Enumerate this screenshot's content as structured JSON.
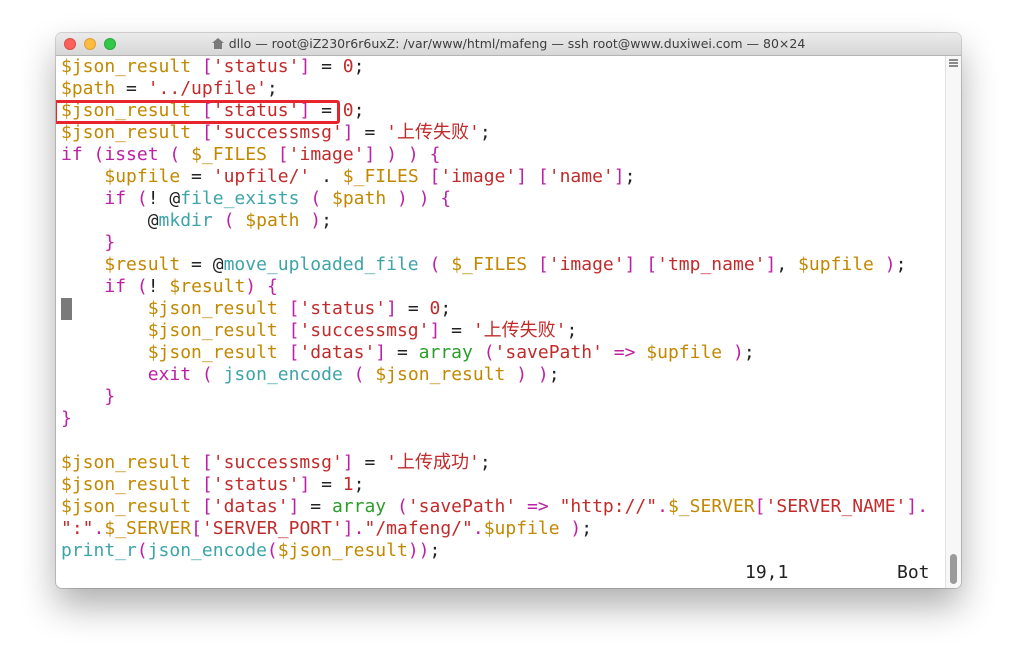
{
  "window": {
    "title": "dllo — root@iZ230r6r6uxZ: /var/www/html/mafeng — ssh root@www.duxiwei.com — 80×24"
  },
  "code_lines": [
    [
      [
        "v",
        "$json_result "
      ],
      [
        "k",
        "["
      ],
      [
        "s",
        "'status'"
      ],
      [
        "k",
        "]"
      ],
      [
        "d",
        " = "
      ],
      [
        "s",
        "0"
      ],
      [
        "d",
        ";"
      ]
    ],
    [
      [
        "v",
        "$path"
      ],
      [
        "d",
        " = "
      ],
      [
        "s",
        "'../upfile'"
      ],
      [
        "d",
        ";"
      ]
    ],
    [
      [
        "v",
        "$json_result "
      ],
      [
        "k",
        "["
      ],
      [
        "s",
        "'status'"
      ],
      [
        "k",
        "]"
      ],
      [
        "d",
        " = "
      ],
      [
        "s",
        "0"
      ],
      [
        "d",
        ";"
      ]
    ],
    [
      [
        "v",
        "$json_result "
      ],
      [
        "k",
        "["
      ],
      [
        "s",
        "'successmsg'"
      ],
      [
        "k",
        "]"
      ],
      [
        "d",
        " = "
      ],
      [
        "s",
        "'上传失败'"
      ],
      [
        "d",
        ";"
      ]
    ],
    [
      [
        "k",
        "if"
      ],
      [
        "d",
        " "
      ],
      [
        "k",
        "("
      ],
      [
        "k",
        "isset"
      ],
      [
        "d",
        " "
      ],
      [
        "k",
        "("
      ],
      [
        "d",
        " "
      ],
      [
        "v",
        "$_FILES "
      ],
      [
        "k",
        "["
      ],
      [
        "s",
        "'image'"
      ],
      [
        "k",
        "]"
      ],
      [
        "d",
        " "
      ],
      [
        "k",
        ")"
      ],
      [
        "d",
        " "
      ],
      [
        "k",
        ")"
      ],
      [
        "d",
        " "
      ],
      [
        "k",
        "{"
      ]
    ],
    [
      [
        "d",
        "    "
      ],
      [
        "v",
        "$upfile"
      ],
      [
        "d",
        " = "
      ],
      [
        "s",
        "'upfile/'"
      ],
      [
        "d",
        " . "
      ],
      [
        "v",
        "$_FILES "
      ],
      [
        "k",
        "["
      ],
      [
        "s",
        "'image'"
      ],
      [
        "k",
        "]"
      ],
      [
        "d",
        " "
      ],
      [
        "k",
        "["
      ],
      [
        "s",
        "'name'"
      ],
      [
        "k",
        "]"
      ],
      [
        "d",
        ";"
      ]
    ],
    [
      [
        "d",
        "    "
      ],
      [
        "k",
        "if"
      ],
      [
        "d",
        " "
      ],
      [
        "k",
        "("
      ],
      [
        "d",
        "! @"
      ],
      [
        "f",
        "file_exists"
      ],
      [
        "d",
        " "
      ],
      [
        "k",
        "("
      ],
      [
        "d",
        " "
      ],
      [
        "v",
        "$path"
      ],
      [
        "d",
        " "
      ],
      [
        "k",
        ")"
      ],
      [
        "d",
        " "
      ],
      [
        "k",
        ")"
      ],
      [
        "d",
        " "
      ],
      [
        "k",
        "{"
      ]
    ],
    [
      [
        "d",
        "        @"
      ],
      [
        "f",
        "mkdir"
      ],
      [
        "d",
        " "
      ],
      [
        "k",
        "("
      ],
      [
        "d",
        " "
      ],
      [
        "v",
        "$path"
      ],
      [
        "d",
        " "
      ],
      [
        "k",
        ")"
      ],
      [
        "d",
        ";"
      ]
    ],
    [
      [
        "d",
        "    "
      ],
      [
        "k",
        "}"
      ]
    ],
    [
      [
        "d",
        "    "
      ],
      [
        "v",
        "$result"
      ],
      [
        "d",
        " = @"
      ],
      [
        "f",
        "move_uploaded_file"
      ],
      [
        "d",
        " "
      ],
      [
        "k",
        "("
      ],
      [
        "d",
        " "
      ],
      [
        "v",
        "$_FILES "
      ],
      [
        "k",
        "["
      ],
      [
        "s",
        "'image'"
      ],
      [
        "k",
        "]"
      ],
      [
        "d",
        " "
      ],
      [
        "k",
        "["
      ],
      [
        "s",
        "'tmp_name'"
      ],
      [
        "k",
        "]"
      ],
      [
        "d",
        ", "
      ],
      [
        "v",
        "$upfile"
      ],
      [
        "d",
        " "
      ],
      [
        "k",
        ")"
      ],
      [
        "d",
        ";"
      ]
    ],
    [
      [
        "d",
        "    "
      ],
      [
        "k",
        "if"
      ],
      [
        "d",
        " "
      ],
      [
        "k",
        "("
      ],
      [
        "d",
        "! "
      ],
      [
        "v",
        "$result"
      ],
      [
        "k",
        ")"
      ],
      [
        "d",
        " "
      ],
      [
        "k",
        "{"
      ]
    ],
    [
      [
        "d",
        "        "
      ],
      [
        "v",
        "$json_result "
      ],
      [
        "k",
        "["
      ],
      [
        "s",
        "'status'"
      ],
      [
        "k",
        "]"
      ],
      [
        "d",
        " = "
      ],
      [
        "s",
        "0"
      ],
      [
        "d",
        ";"
      ]
    ],
    [
      [
        "d",
        "        "
      ],
      [
        "v",
        "$json_result "
      ],
      [
        "k",
        "["
      ],
      [
        "s",
        "'successmsg'"
      ],
      [
        "k",
        "]"
      ],
      [
        "d",
        " = "
      ],
      [
        "s",
        "'上传失败'"
      ],
      [
        "d",
        ";"
      ]
    ],
    [
      [
        "d",
        "        "
      ],
      [
        "v",
        "$json_result "
      ],
      [
        "k",
        "["
      ],
      [
        "s",
        "'datas'"
      ],
      [
        "k",
        "]"
      ],
      [
        "d",
        " = "
      ],
      [
        "g",
        "array"
      ],
      [
        "d",
        " "
      ],
      [
        "k",
        "("
      ],
      [
        "s",
        "'savePath'"
      ],
      [
        "d",
        " "
      ],
      [
        "k",
        "=>"
      ],
      [
        "d",
        " "
      ],
      [
        "v",
        "$upfile"
      ],
      [
        "d",
        " "
      ],
      [
        "k",
        ")"
      ],
      [
        "d",
        ";"
      ]
    ],
    [
      [
        "d",
        "        "
      ],
      [
        "k",
        "exit"
      ],
      [
        "d",
        " "
      ],
      [
        "k",
        "("
      ],
      [
        "d",
        " "
      ],
      [
        "f",
        "json_encode"
      ],
      [
        "d",
        " "
      ],
      [
        "k",
        "("
      ],
      [
        "d",
        " "
      ],
      [
        "v",
        "$json_result"
      ],
      [
        "d",
        " "
      ],
      [
        "k",
        ")"
      ],
      [
        "d",
        " "
      ],
      [
        "k",
        ")"
      ],
      [
        "d",
        ";"
      ]
    ],
    [
      [
        "d",
        "    "
      ],
      [
        "k",
        "}"
      ]
    ],
    [
      [
        "k",
        "}"
      ]
    ],
    [],
    [
      [
        "v",
        "$json_result "
      ],
      [
        "k",
        "["
      ],
      [
        "s",
        "'successmsg'"
      ],
      [
        "k",
        "]"
      ],
      [
        "d",
        " = "
      ],
      [
        "s",
        "'上传成功'"
      ],
      [
        "d",
        ";"
      ]
    ],
    [
      [
        "v",
        "$json_result "
      ],
      [
        "k",
        "["
      ],
      [
        "s",
        "'status'"
      ],
      [
        "k",
        "]"
      ],
      [
        "d",
        " = "
      ],
      [
        "s",
        "1"
      ],
      [
        "d",
        ";"
      ]
    ],
    [
      [
        "v",
        "$json_result "
      ],
      [
        "k",
        "["
      ],
      [
        "s",
        "'datas'"
      ],
      [
        "k",
        "]"
      ],
      [
        "d",
        " = "
      ],
      [
        "g",
        "array"
      ],
      [
        "d",
        " "
      ],
      [
        "k",
        "("
      ],
      [
        "s",
        "'savePath'"
      ],
      [
        "d",
        " "
      ],
      [
        "k",
        "=>"
      ],
      [
        "d",
        " "
      ],
      [
        "s",
        "\"http://\""
      ],
      [
        "k",
        "."
      ],
      [
        "v",
        "$_SERVER"
      ],
      [
        "k",
        "["
      ],
      [
        "s",
        "'SERVER_NAME'"
      ],
      [
        "k",
        "]"
      ],
      [
        "k",
        "."
      ]
    ],
    [
      [
        "s",
        "\":\""
      ],
      [
        "k",
        "."
      ],
      [
        "v",
        "$_SERVER"
      ],
      [
        "k",
        "["
      ],
      [
        "s",
        "'SERVER_PORT'"
      ],
      [
        "k",
        "]"
      ],
      [
        "k",
        "."
      ],
      [
        "s",
        "\"/mafeng/\""
      ],
      [
        "k",
        "."
      ],
      [
        "v",
        "$upfile"
      ],
      [
        "d",
        " "
      ],
      [
        "k",
        ")"
      ],
      [
        "d",
        ";"
      ]
    ],
    [
      [
        "f",
        "print_r"
      ],
      [
        "k",
        "("
      ],
      [
        "f",
        "json_encode"
      ],
      [
        "k",
        "("
      ],
      [
        "v",
        "$json_result"
      ],
      [
        "k",
        "))"
      ],
      [
        "d",
        ";"
      ]
    ]
  ],
  "status": {
    "position": "19,1",
    "scroll": "Bot"
  },
  "colors": {
    "variable": "#c28800",
    "string": "#c22b2b",
    "keyword": "#bd20a4",
    "function": "#3da4a9",
    "array": "#2a9e2a",
    "highlight_box": "#e8252d"
  }
}
